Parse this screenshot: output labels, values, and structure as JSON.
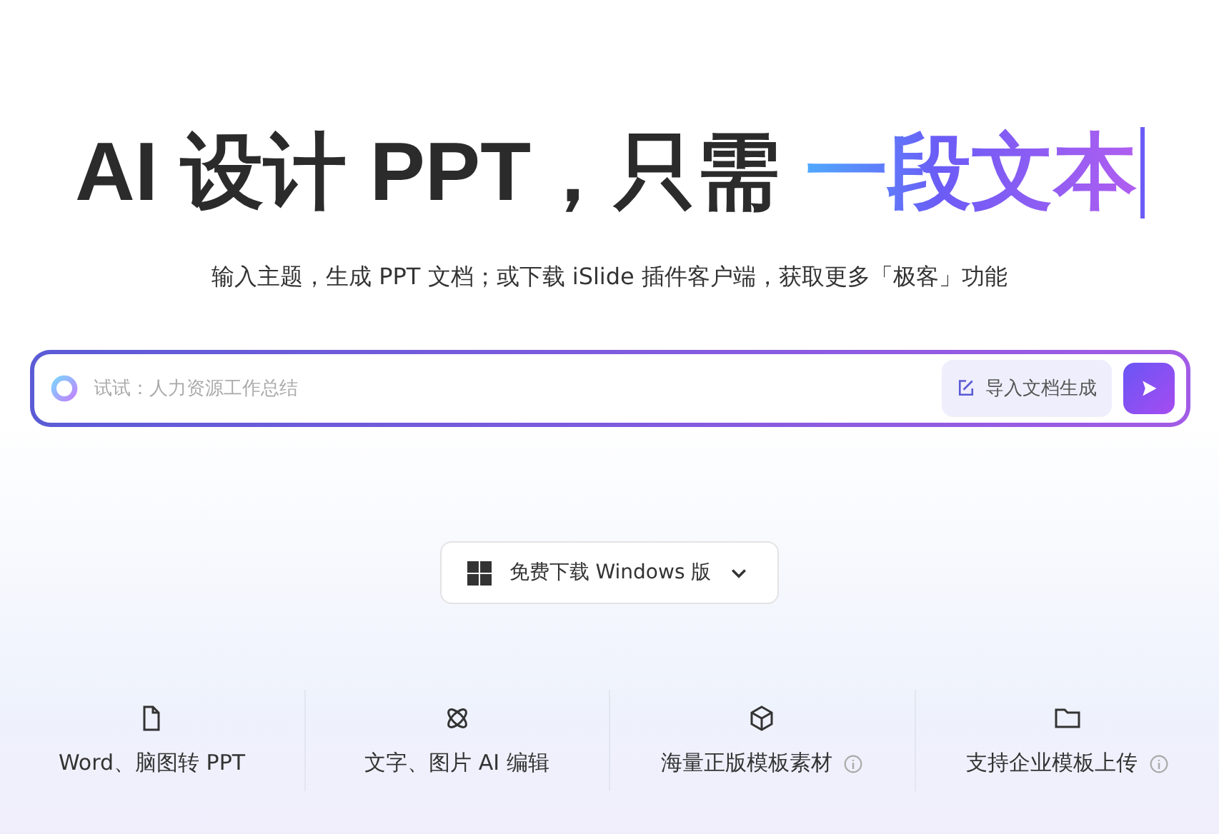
{
  "headline": {
    "text": "AI 设计 PPT，只需",
    "highlight": "一段文本"
  },
  "subtitle": "输入主题，生成 PPT 文档；或下载 iSlide 插件客户端，获取更多「极客」功能",
  "prompt": {
    "placeholder": "试试：人力资源工作总结",
    "import_button": "导入文档生成"
  },
  "download_button": "免费下载 Windows 版",
  "features": [
    {
      "kind": "document",
      "label": "Word、脑图转 PPT",
      "info": false
    },
    {
      "kind": "atom",
      "label": "文字、图片 AI 编辑",
      "info": false
    },
    {
      "kind": "cube",
      "label": "海量正版模板素材",
      "info": true
    },
    {
      "kind": "folder",
      "label": "支持企业模板上传",
      "info": true
    }
  ]
}
